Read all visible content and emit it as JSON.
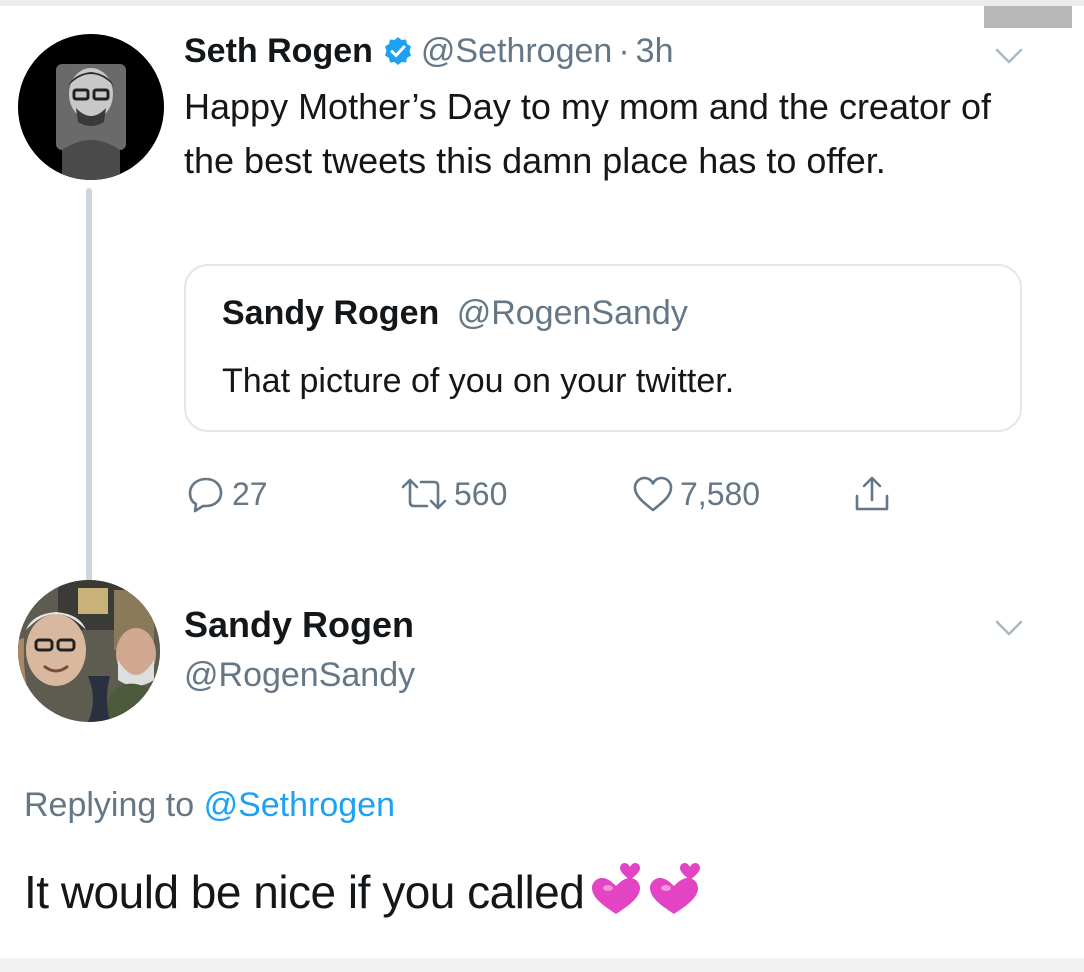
{
  "tweet": {
    "author_name": "Seth Rogen",
    "author_handle": "@Sethrogen",
    "separator": "·",
    "time": "3h",
    "text": "Happy Mother’s Day to my mom and the creator of the best tweets this damn place has to offer.",
    "quote": {
      "author_name": "Sandy Rogen",
      "author_handle": "@RogenSandy",
      "text": "That picture of you on your twitter."
    },
    "actions": {
      "replies": "27",
      "retweets": "560",
      "likes": "7,580"
    }
  },
  "reply": {
    "author_name": "Sandy Rogen",
    "author_handle": "@RogenSandy",
    "replying_prefix": "Replying to",
    "replying_mention": "@Sethrogen",
    "text": "It would be nice if you called"
  },
  "icons": {
    "verified": "verified-badge-icon",
    "menu": "chevron-down-icon",
    "reply": "reply-bubble-icon",
    "retweet": "retweet-icon",
    "like": "heart-outline-icon",
    "share": "share-upload-icon",
    "emoji": "two-hearts-emoji"
  },
  "colors": {
    "link_blue": "#1da1f2",
    "muted_gray": "#657786",
    "text_dark": "#14171a",
    "border": "#e1e8ed",
    "emoji_pink": "#e244c4"
  }
}
